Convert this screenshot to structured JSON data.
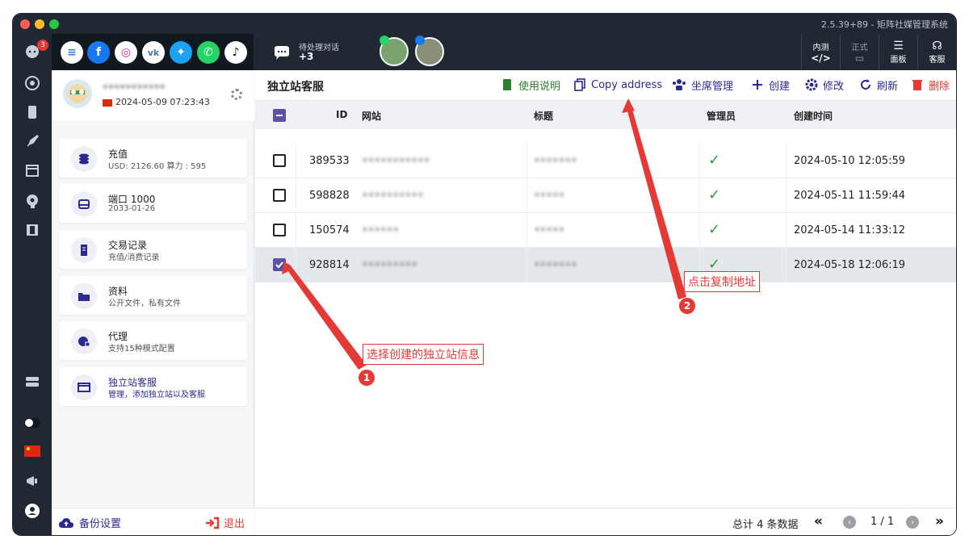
{
  "app": {
    "version": "2.5.39+89 - 矩阵社媒管理系统"
  },
  "rail": {
    "badge": "3"
  },
  "topbar": {
    "pending_label": "待处理对话",
    "pending_count": "+3",
    "inner_test": "内测",
    "official": "正式",
    "panel": "面板",
    "service": "客服"
  },
  "profile": {
    "name": "•••••••••••",
    "date": "2024-05-09 07:23:43"
  },
  "sidebar": {
    "items": [
      {
        "title": "充值",
        "sub": "USD: 2126.60  算力 : 595"
      },
      {
        "title": "端口 1000",
        "sub": "2033-01-26"
      },
      {
        "title": "交易记录",
        "sub": "充值/消费记录"
      },
      {
        "title": "资料",
        "sub": "公开文件，私有文件"
      },
      {
        "title": "代理",
        "sub": "支持15种模式配置"
      },
      {
        "title": "独立站客服",
        "sub": "管理，添加独立站以及客服"
      }
    ],
    "backup": "备份设置",
    "logout": "退出"
  },
  "main": {
    "title": "独立站客服",
    "actions": {
      "guide": "使用说明",
      "copy": "Copy address",
      "seats": "坐席管理",
      "create": "创建",
      "edit": "修改",
      "refresh": "刷新",
      "delete": "删除"
    },
    "columns": {
      "id": "ID",
      "site": "网站",
      "title": "标题",
      "admin": "管理员",
      "created": "创建时间"
    },
    "rows": [
      {
        "id": "389533",
        "site": "•••••••••••",
        "title": "•••••••",
        "admin": "✓",
        "created": "2024-05-10 12:05:59",
        "checked": false
      },
      {
        "id": "598828",
        "site": "••••••••••",
        "title": "•••••",
        "admin": "✓",
        "created": "2024-05-11 11:59:44",
        "checked": false
      },
      {
        "id": "150574",
        "site": "••••••",
        "title": "•••••",
        "admin": "✓",
        "created": "2024-05-14 11:33:12",
        "checked": false
      },
      {
        "id": "928814",
        "site": "•••••••••",
        "title": "•••••••",
        "admin": "✓",
        "created": "2024-05-18 12:06:19",
        "checked": true
      }
    ],
    "footer": {
      "total": "总计 4 条数据",
      "page": "1 / 1"
    }
  },
  "annotations": {
    "step1_label": "选择创建的独立站信息",
    "step1_num": "1",
    "step2_label": "点击复制地址",
    "step2_num": "2"
  },
  "colors": {
    "accent": "#2c2a8f",
    "danger": "#e53935",
    "success": "#2e9a44",
    "dark": "#1f2833"
  }
}
